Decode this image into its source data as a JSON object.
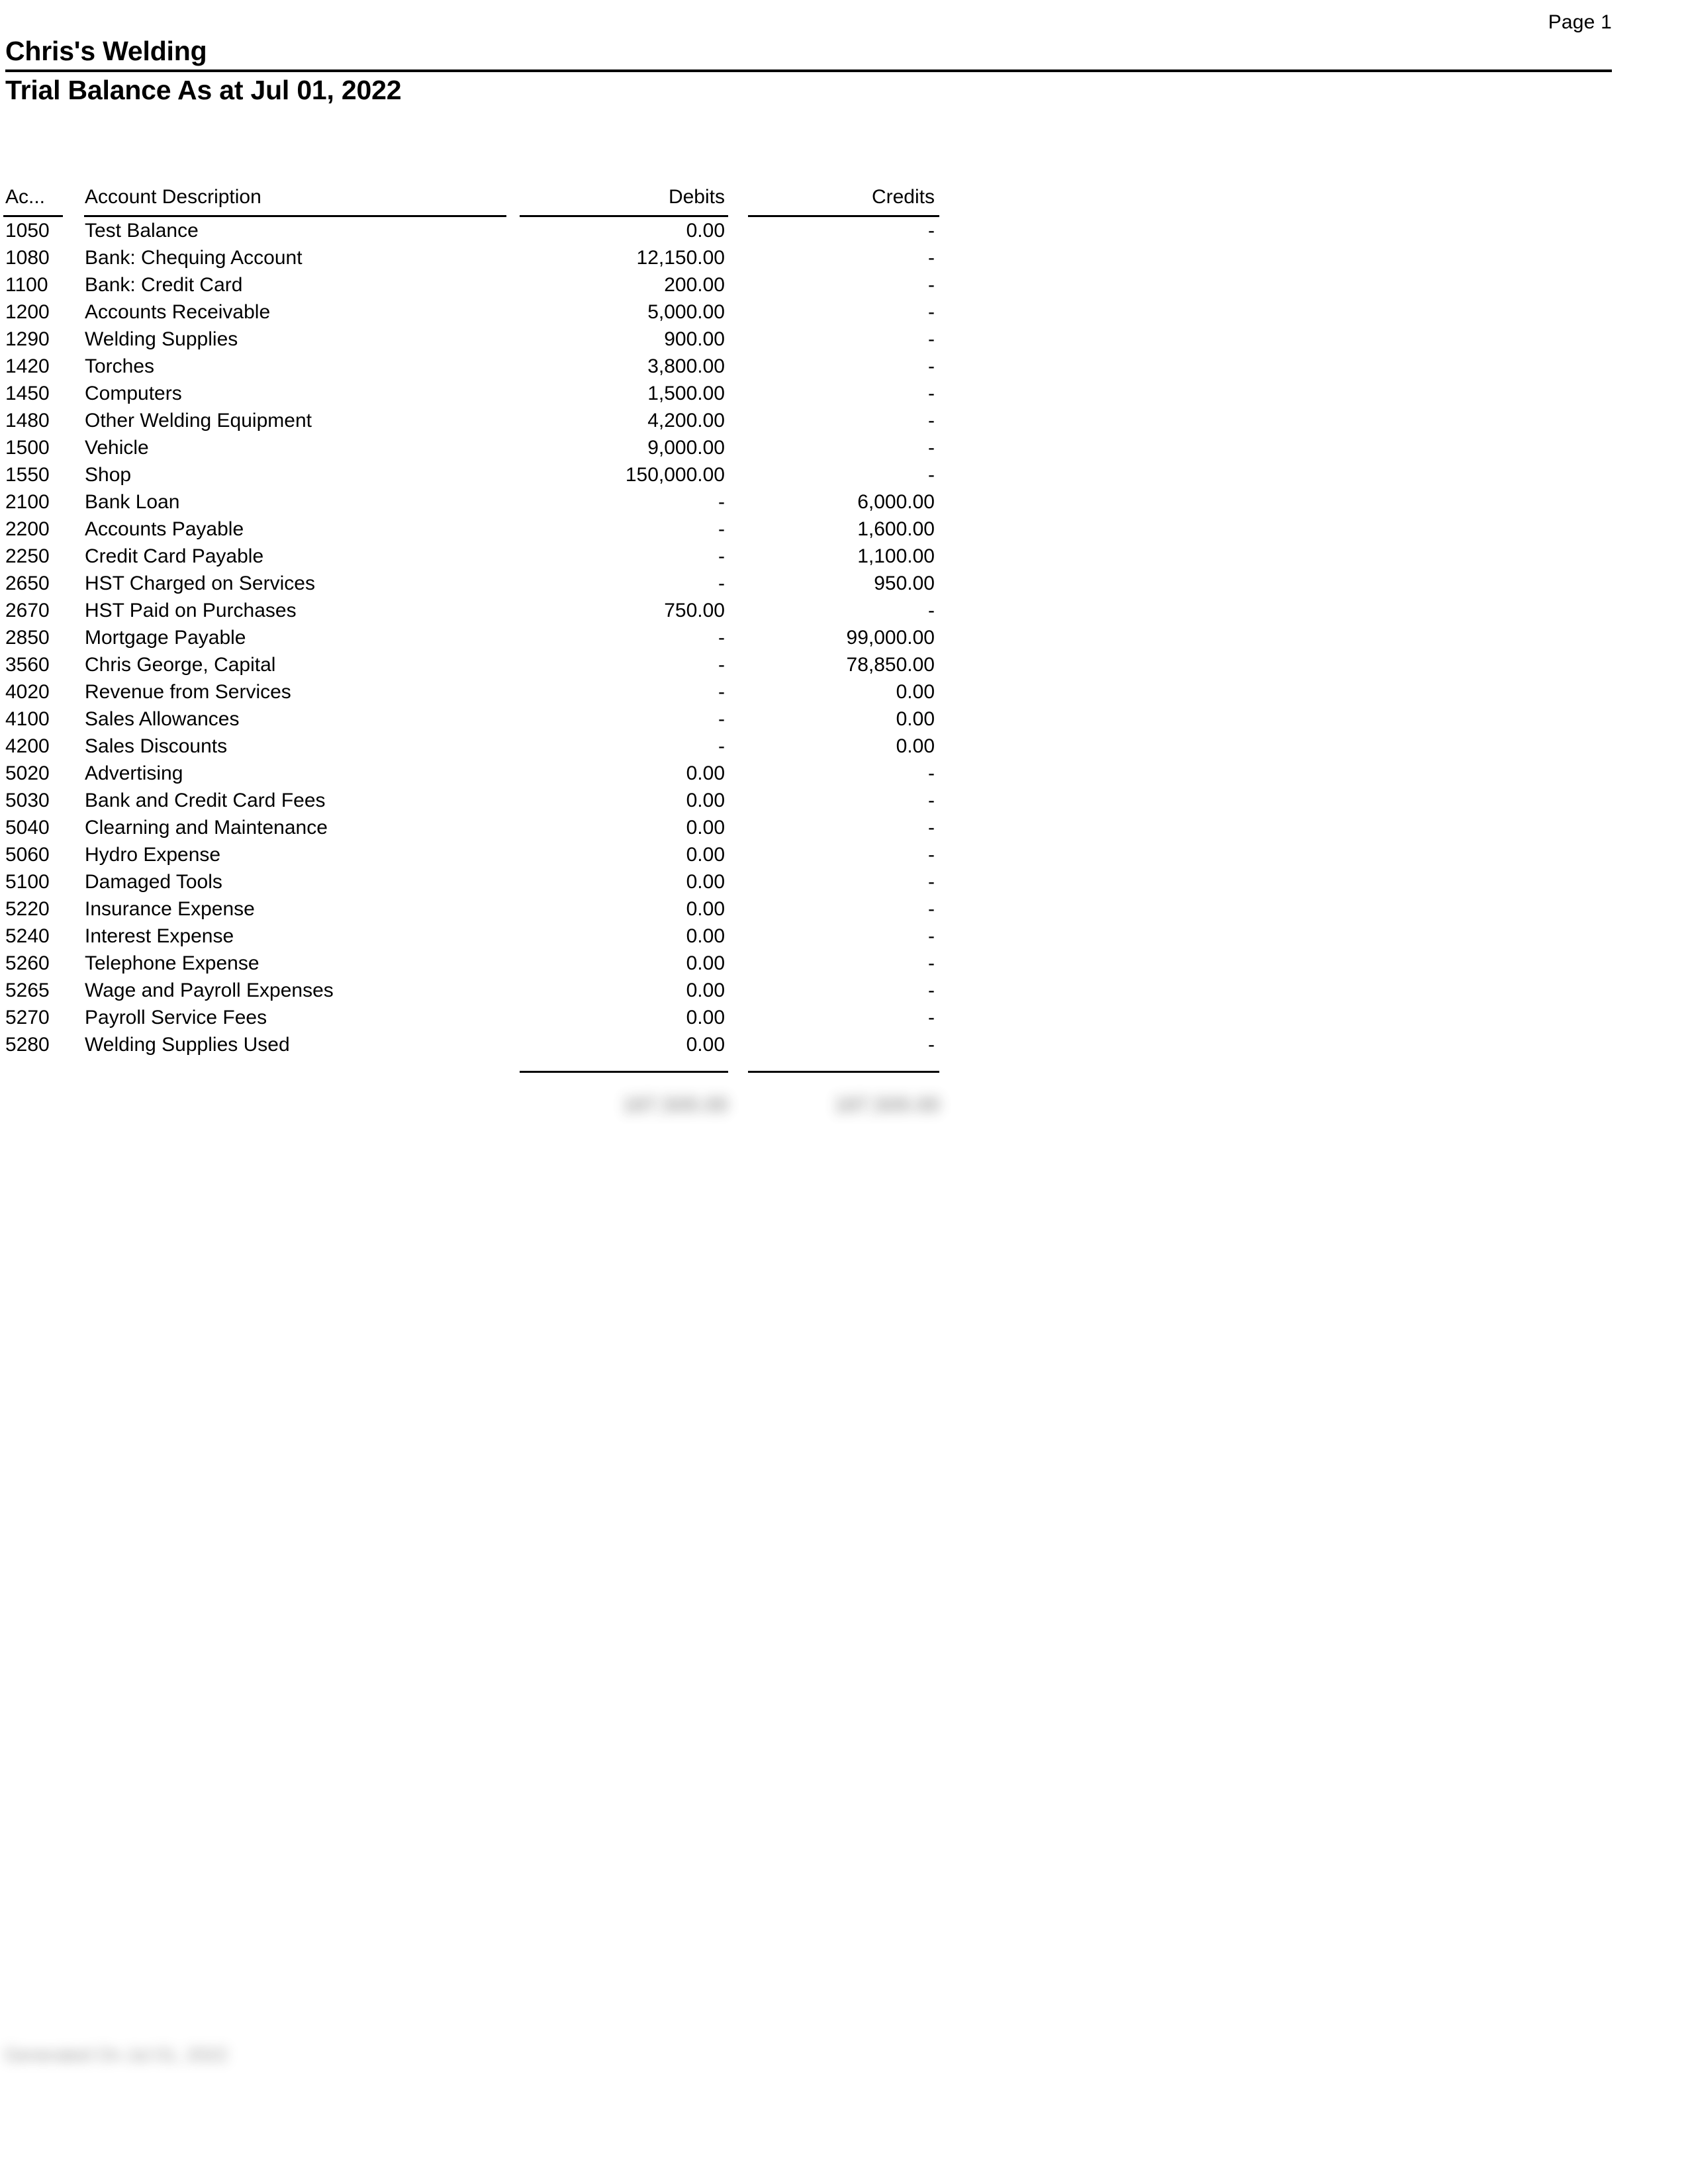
{
  "page": {
    "page_label": "Page 1"
  },
  "report": {
    "company_name": "Chris's Welding",
    "title": "Trial Balance As at Jul 01, 2022"
  },
  "table": {
    "headers": {
      "account": "Ac...",
      "description": "Account Description",
      "debits": "Debits",
      "credits": "Credits"
    },
    "rows": [
      {
        "account": "1050",
        "description": "Test Balance",
        "debits": "0.00",
        "credits": "-"
      },
      {
        "account": "1080",
        "description": "Bank: Chequing Account",
        "debits": "12,150.00",
        "credits": "-"
      },
      {
        "account": "1100",
        "description": "Bank: Credit Card",
        "debits": "200.00",
        "credits": "-"
      },
      {
        "account": "1200",
        "description": "Accounts Receivable",
        "debits": "5,000.00",
        "credits": "-"
      },
      {
        "account": "1290",
        "description": "Welding Supplies",
        "debits": "900.00",
        "credits": "-"
      },
      {
        "account": "1420",
        "description": "Torches",
        "debits": "3,800.00",
        "credits": "-"
      },
      {
        "account": "1450",
        "description": "Computers",
        "debits": "1,500.00",
        "credits": "-"
      },
      {
        "account": "1480",
        "description": "Other Welding Equipment",
        "debits": "4,200.00",
        "credits": "-"
      },
      {
        "account": "1500",
        "description": "Vehicle",
        "debits": "9,000.00",
        "credits": "-"
      },
      {
        "account": "1550",
        "description": "Shop",
        "debits": "150,000.00",
        "credits": "-"
      },
      {
        "account": "2100",
        "description": "Bank Loan",
        "debits": "-",
        "credits": "6,000.00"
      },
      {
        "account": "2200",
        "description": "Accounts Payable",
        "debits": "-",
        "credits": "1,600.00"
      },
      {
        "account": "2250",
        "description": "Credit Card Payable",
        "debits": "-",
        "credits": "1,100.00"
      },
      {
        "account": "2650",
        "description": "HST Charged on Services",
        "debits": "-",
        "credits": "950.00"
      },
      {
        "account": "2670",
        "description": "HST Paid on Purchases",
        "debits": "750.00",
        "credits": "-"
      },
      {
        "account": "2850",
        "description": "Mortgage Payable",
        "debits": "-",
        "credits": "99,000.00"
      },
      {
        "account": "3560",
        "description": "Chris George, Capital",
        "debits": "-",
        "credits": "78,850.00"
      },
      {
        "account": "4020",
        "description": "Revenue from Services",
        "debits": "-",
        "credits": "0.00"
      },
      {
        "account": "4100",
        "description": "Sales Allowances",
        "debits": "-",
        "credits": "0.00"
      },
      {
        "account": "4200",
        "description": "Sales Discounts",
        "debits": "-",
        "credits": "0.00"
      },
      {
        "account": "5020",
        "description": "Advertising",
        "debits": "0.00",
        "credits": "-"
      },
      {
        "account": "5030",
        "description": "Bank and Credit Card Fees",
        "debits": "0.00",
        "credits": "-"
      },
      {
        "account": "5040",
        "description": "Clearning and Maintenance",
        "debits": "0.00",
        "credits": "-"
      },
      {
        "account": "5060",
        "description": "Hydro Expense",
        "debits": "0.00",
        "credits": "-"
      },
      {
        "account": "5100",
        "description": "Damaged Tools",
        "debits": "0.00",
        "credits": "-"
      },
      {
        "account": "5220",
        "description": "Insurance Expense",
        "debits": "0.00",
        "credits": "-"
      },
      {
        "account": "5240",
        "description": "Interest Expense",
        "debits": "0.00",
        "credits": "-"
      },
      {
        "account": "5260",
        "description": "Telephone Expense",
        "debits": "0.00",
        "credits": "-"
      },
      {
        "account": "5265",
        "description": "Wage and Payroll Expenses",
        "debits": "0.00",
        "credits": "-"
      },
      {
        "account": "5270",
        "description": "Payroll Service Fees",
        "debits": "0.00",
        "credits": "-"
      },
      {
        "account": "5280",
        "description": "Welding Supplies Used",
        "debits": "0.00",
        "credits": "-"
      }
    ],
    "totals": {
      "debits": "187,500.00",
      "credits": "187,500.00"
    }
  },
  "footer": {
    "generated_note": "Generated On Jul 01, 2022"
  }
}
